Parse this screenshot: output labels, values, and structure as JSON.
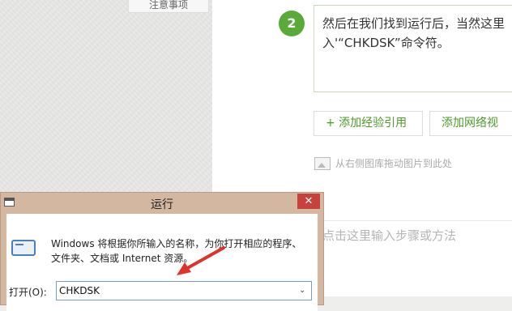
{
  "top_tab": {
    "label": "注意事项"
  },
  "step": {
    "number": "2",
    "text_line1": "然后在我们找到运行后，当然这里",
    "text_line2": "入'“CHKDSK”命令符。"
  },
  "buttons": {
    "add_citation": "+ 添加经验引用",
    "add_web": "添加网络视"
  },
  "drag_hint": "从右侧图库拖动图片到此处",
  "input_step_placeholder": "点击这里输入步骤或方法",
  "run_dialog": {
    "title": "运行",
    "close_glyph": "✕",
    "description_line1": "Windows 将根据你所输入的名称，为你打开相应的程序、",
    "description_line2": "文件夹、文档或 Internet 资源。",
    "open_label": "打开(O):",
    "open_value": "CHKDSK",
    "dropdown_glyph": "⌄"
  },
  "colors": {
    "accent_green": "#5aaa3a",
    "arrow_red": "#e0312b",
    "close_red": "#c7423c"
  }
}
